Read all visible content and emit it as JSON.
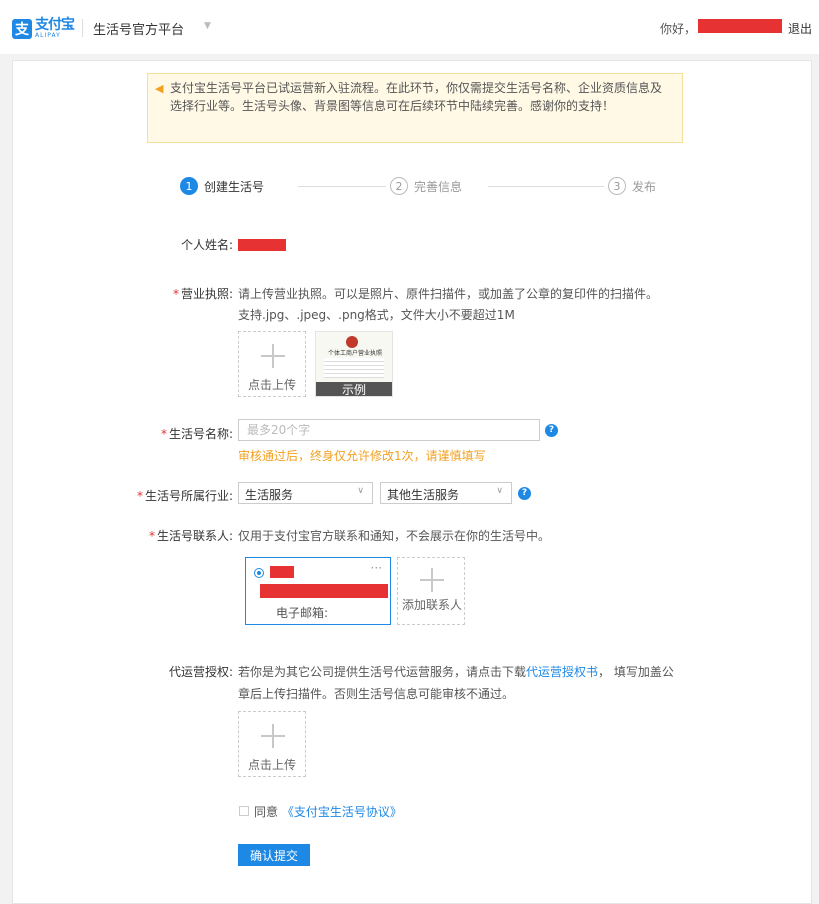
{
  "header": {
    "logo_cn": "支付宝",
    "logo_en": "ALIPAY",
    "platform_title": "生活号官方平台",
    "greeting": "你好，",
    "logout": "退出"
  },
  "notice": {
    "text": "支付宝生活号平台已试运营新入驻流程。在此环节，你仅需提交生活号名称、企业资质信息及选择行业等。生活号头像、背景图等信息可在后续环节中陆续完善。感谢你的支持！"
  },
  "steps": [
    {
      "num": "1",
      "label": "创建生活号",
      "state": "active"
    },
    {
      "num": "2",
      "label": "完善信息",
      "state": "inactive"
    },
    {
      "num": "3",
      "label": "发布",
      "state": "inactive"
    }
  ],
  "form": {
    "personal_name": {
      "label": "个人姓名:"
    },
    "license": {
      "required_mark": "*",
      "label": "营业执照:",
      "desc1": "请上传营业执照。可以是照片、原件扫描件，或加盖了公章的复印件的扫描件。",
      "desc2": "支持.jpg、.jpeg、.png格式，文件大小不要超过1M",
      "upload_text": "点击上传",
      "example_label": "示例",
      "example_heading": "个体工商户营业执照"
    },
    "name": {
      "required_mark": "*",
      "label": "生活号名称:",
      "placeholder": "最多20个字",
      "help": "?",
      "warning": "审核通过后，终身仅允许修改1次，请谨慎填写"
    },
    "industry": {
      "required_mark": "*",
      "label": "生活号所属行业:",
      "primary": "生活服务",
      "secondary": "其他生活服务",
      "help": "?"
    },
    "contact": {
      "required_mark": "*",
      "label": "生活号联系人:",
      "desc": "仅用于支付宝官方联系和通知，不会展示在你的生活号中。",
      "more": "···",
      "email_label": "电子邮箱:",
      "add_text": "添加联系人"
    },
    "agency": {
      "label": "代运营授权:",
      "desc_before": "若你是为其它公司提供生活号代运营服务，请点击下载",
      "link": "代运营授权书",
      "desc_after": "， 填写加盖公",
      "desc_line2": "章后上传扫描件。否则生活号信息可能审核不通过。",
      "upload_text": "点击上传"
    },
    "agreement": {
      "prefix": "同意",
      "link": "《支付宝生活号协议》"
    },
    "submit_label": "确认提交"
  }
}
